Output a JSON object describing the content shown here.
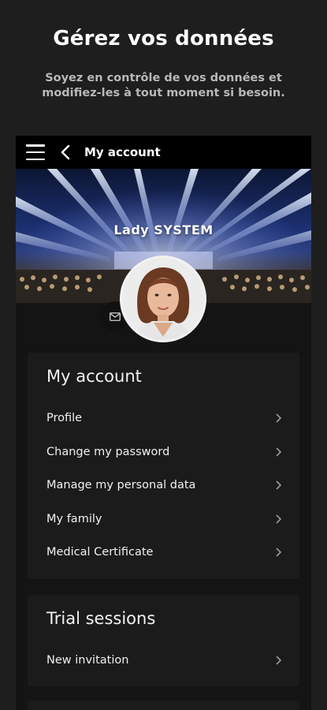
{
  "promo": {
    "title": "Gérez vos données",
    "subtitle": "Soyez en contrôle de vos données et modifiez-les à tout moment si besoin."
  },
  "topbar": {
    "title": "My account",
    "menu_icon": "hamburger-menu-icon",
    "back_icon": "chevron-left-icon"
  },
  "hero": {
    "name": "Lady  SYSTEM",
    "mail_icon": "envelope-icon"
  },
  "account_section": {
    "title": "My account",
    "items": [
      {
        "label": "Profile"
      },
      {
        "label": "Change my password"
      },
      {
        "label": "Manage my personal data"
      },
      {
        "label": "My family"
      },
      {
        "label": "Medical Certificate"
      }
    ]
  },
  "trial_section": {
    "title": "Trial sessions",
    "items": [
      {
        "label": "New invitation"
      }
    ]
  },
  "colors": {
    "background": "#1e1e1e",
    "topbar": "#000000",
    "card": "#1b1b1b",
    "text": "#ffffff",
    "subtitle": "#b8b8b8"
  }
}
